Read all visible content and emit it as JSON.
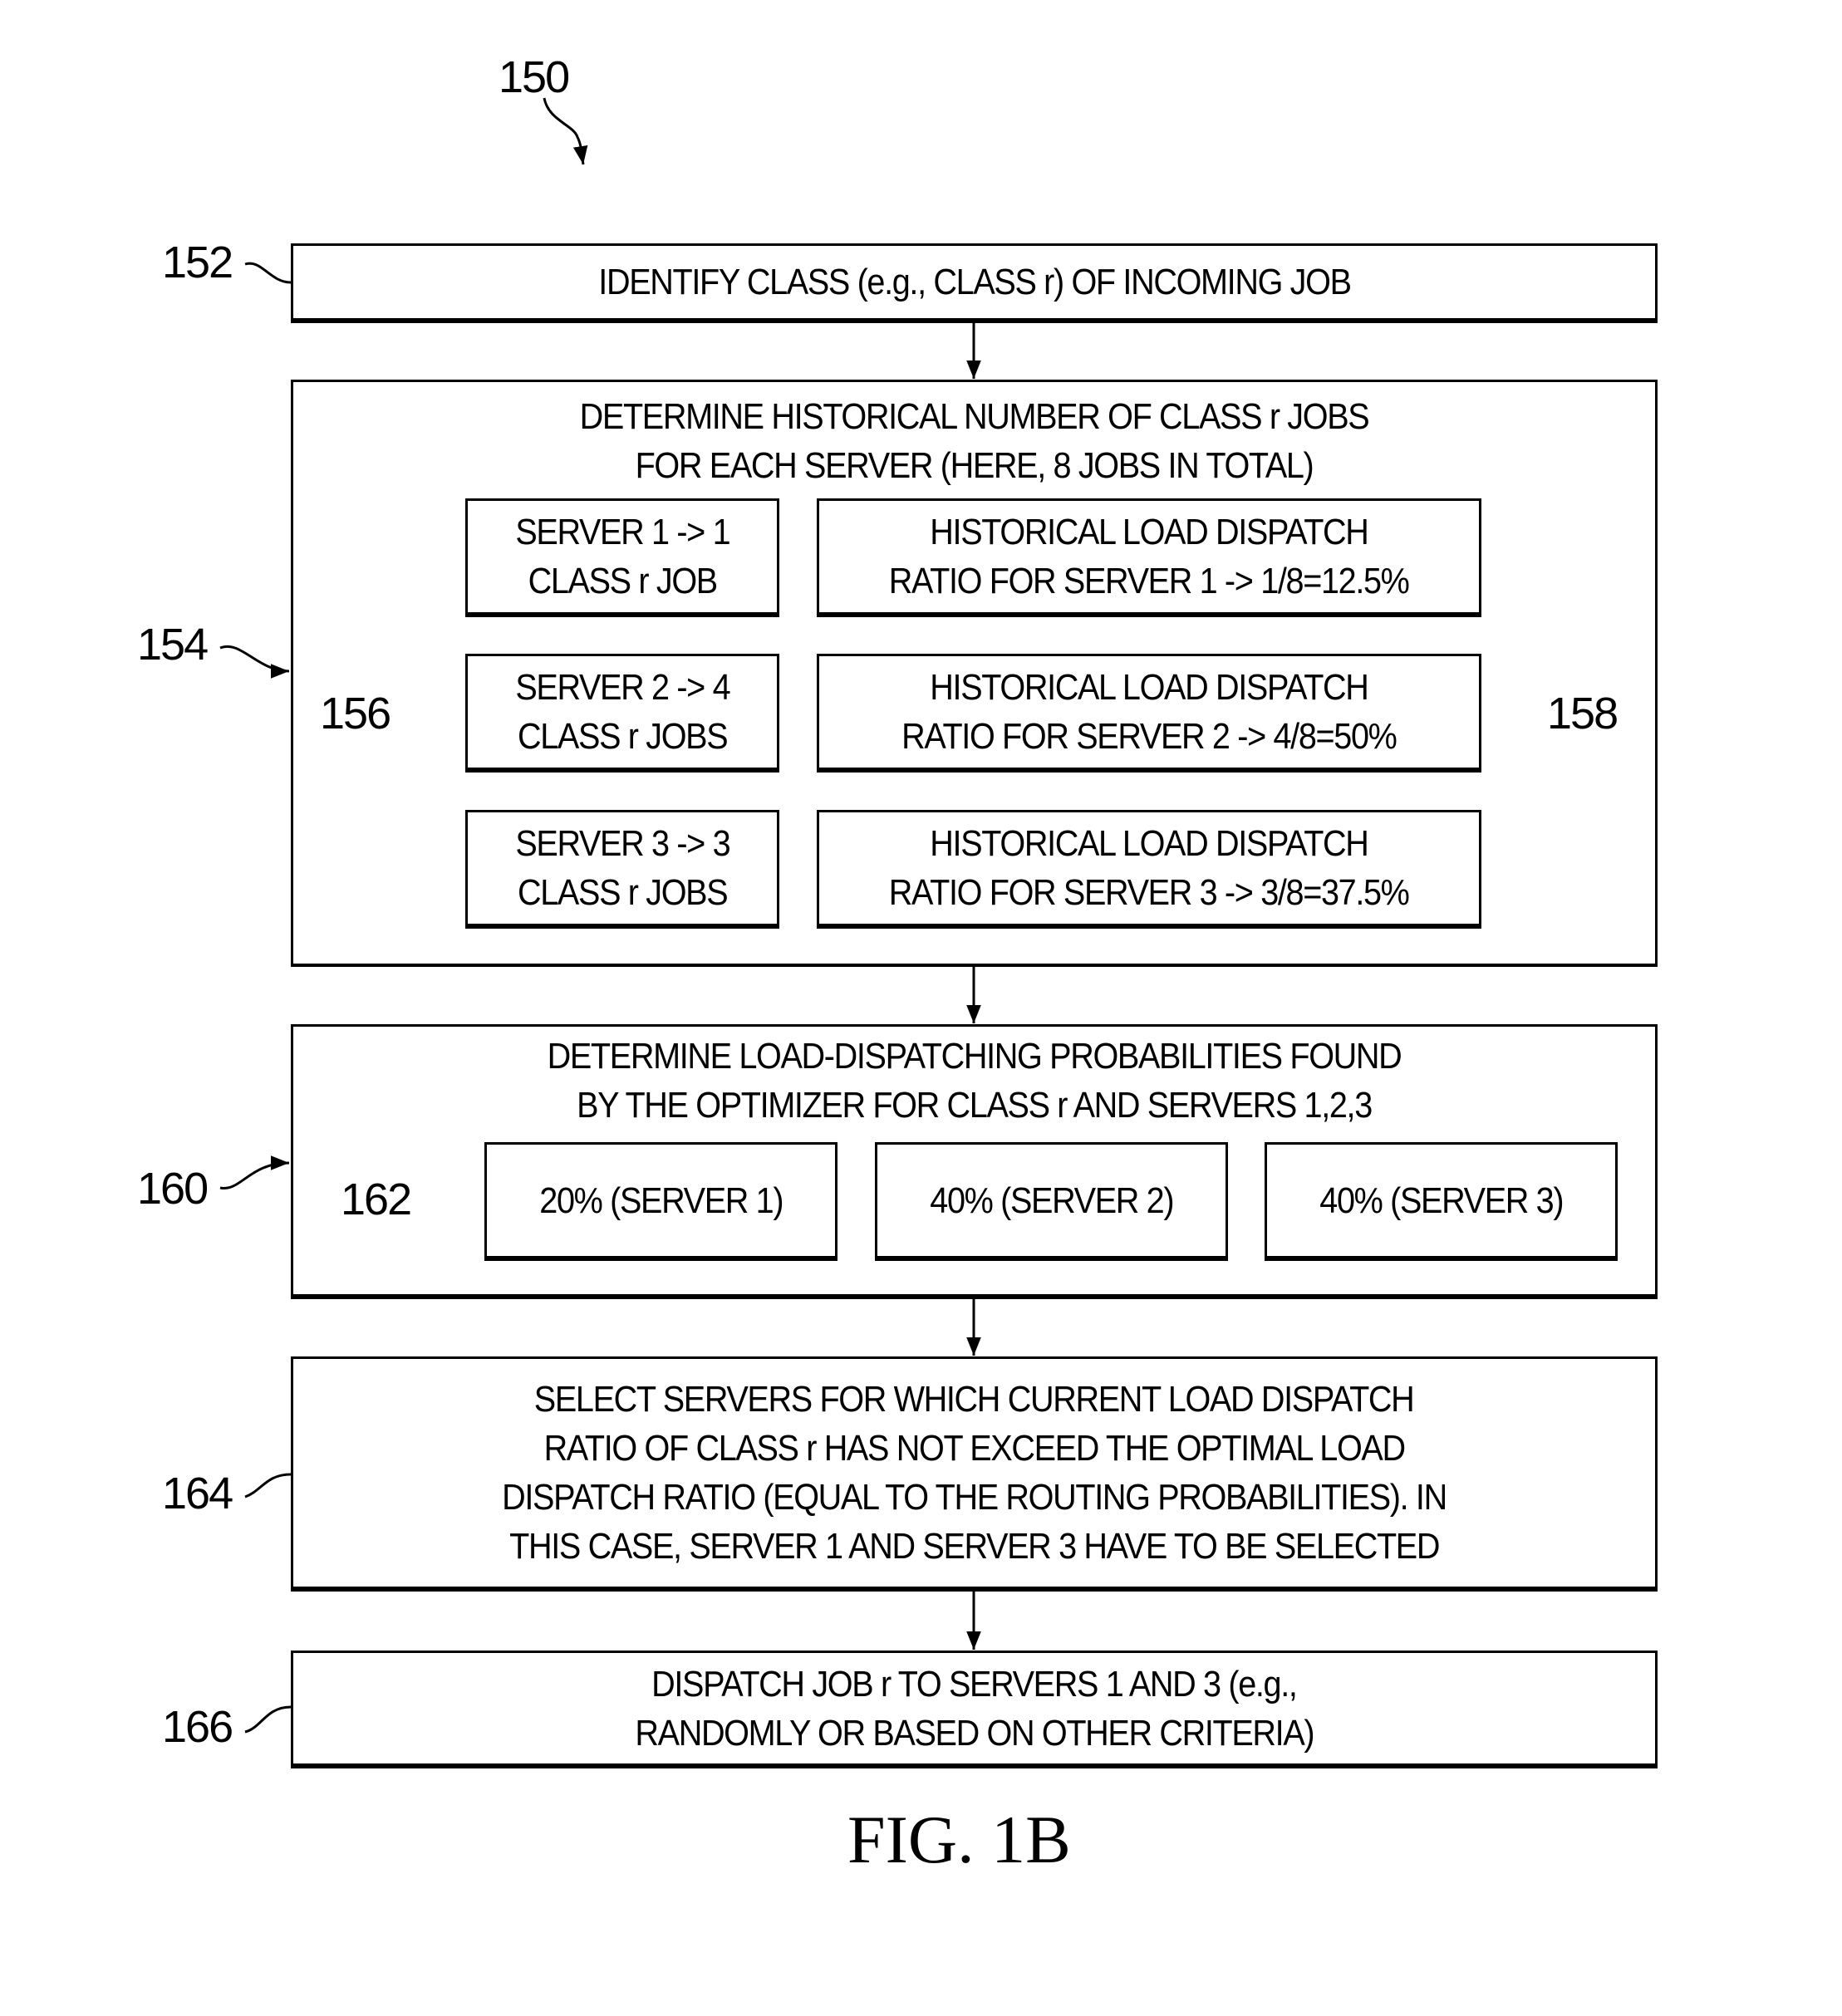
{
  "figure": {
    "reference": "150",
    "caption": "FIG. 1B"
  },
  "steps": {
    "identify": {
      "ref": "152",
      "text": "IDENTIFY CLASS (e.g., CLASS r) OF INCOMING JOB"
    },
    "historical": {
      "ref": "154",
      "lines": [
        "DETERMINE HISTORICAL NUMBER OF CLASS r JOBS",
        "FOR EACH SERVER (HERE, 8 JOBS IN TOTAL)"
      ],
      "counts_ref": "156",
      "ratios_ref": "158",
      "rows": [
        {
          "count_lines": [
            "SERVER 1 -> 1",
            "CLASS r JOB"
          ],
          "ratio_lines": [
            "HISTORICAL LOAD DISPATCH",
            "RATIO FOR SERVER 1 -> 1/8=12.5%"
          ]
        },
        {
          "count_lines": [
            "SERVER 2 -> 4",
            "CLASS r JOBS"
          ],
          "ratio_lines": [
            "HISTORICAL LOAD DISPATCH",
            "RATIO FOR SERVER 2 -> 4/8=50%"
          ]
        },
        {
          "count_lines": [
            "SERVER 3 -> 3",
            "CLASS r JOBS"
          ],
          "ratio_lines": [
            "HISTORICAL LOAD DISPATCH",
            "RATIO FOR SERVER 3 -> 3/8=37.5%"
          ]
        }
      ]
    },
    "probabilities": {
      "ref": "160",
      "lines": [
        "DETERMINE LOAD-DISPATCHING PROBABILITIES FOUND",
        "BY THE OPTIMIZER FOR CLASS r AND SERVERS 1,2,3"
      ],
      "group_ref": "162",
      "items": [
        "20% (SERVER 1)",
        "40% (SERVER 2)",
        "40% (SERVER 3)"
      ]
    },
    "select": {
      "ref": "164",
      "lines": [
        "SELECT SERVERS FOR WHICH CURRENT LOAD DISPATCH",
        "RATIO OF CLASS r HAS NOT EXCEED THE OPTIMAL LOAD",
        "DISPATCH RATIO (EQUAL TO THE ROUTING PROBABILITIES). IN",
        "THIS CASE, SERVER 1 AND SERVER 3 HAVE TO BE SELECTED"
      ]
    },
    "dispatch": {
      "ref": "166",
      "lines": [
        "DISPATCH JOB r TO SERVERS 1 AND 3 (e.g.,",
        "RANDOMLY OR BASED ON OTHER CRITERIA)"
      ]
    }
  }
}
